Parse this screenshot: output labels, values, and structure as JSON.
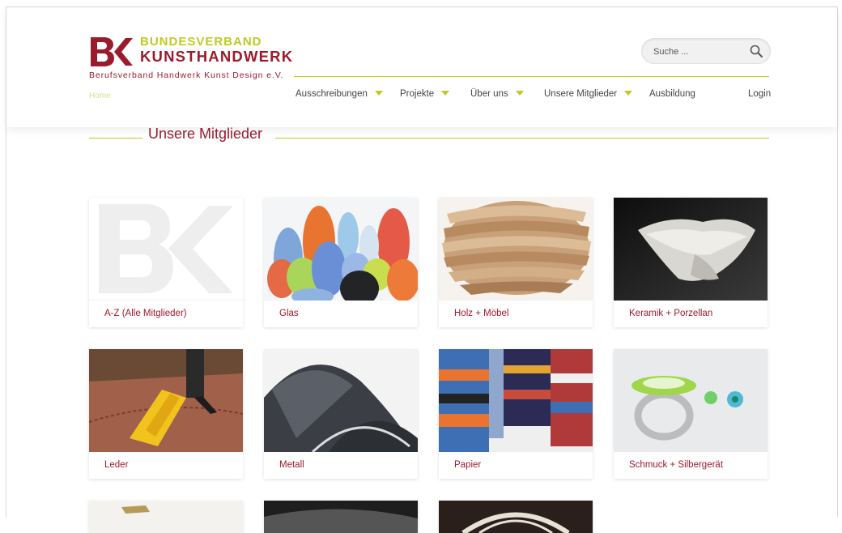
{
  "brand": {
    "logo_top": "BUNDESVERBAND",
    "logo_bottom": "KUNSTHANDWERK",
    "logo_sub": "Berufsverband Handwerk Kunst Design e.V."
  },
  "search": {
    "placeholder": "Suche ..."
  },
  "breadcrumb": {
    "home": "Home"
  },
  "nav": {
    "items": [
      {
        "label": "Ausschreibungen",
        "has_dropdown": true
      },
      {
        "label": "Projekte",
        "has_dropdown": true
      },
      {
        "label": "Über uns",
        "has_dropdown": true
      },
      {
        "label": "Unsere Mitglieder",
        "has_dropdown": true
      },
      {
        "label": "Ausbildung",
        "has_dropdown": false
      }
    ],
    "login": "Login"
  },
  "page": {
    "title": "Unsere Mitglieder"
  },
  "categories": [
    {
      "label": "A-Z (Alle Mitglieder)"
    },
    {
      "label": "Glas"
    },
    {
      "label": "Holz + Möbel"
    },
    {
      "label": "Keramik + Porzellan"
    },
    {
      "label": "Leder"
    },
    {
      "label": "Metall"
    },
    {
      "label": "Papier"
    },
    {
      "label": "Schmuck + Silbergerät"
    }
  ],
  "colors": {
    "brand_red": "#9b1b2c",
    "brand_green": "#bfca21"
  }
}
